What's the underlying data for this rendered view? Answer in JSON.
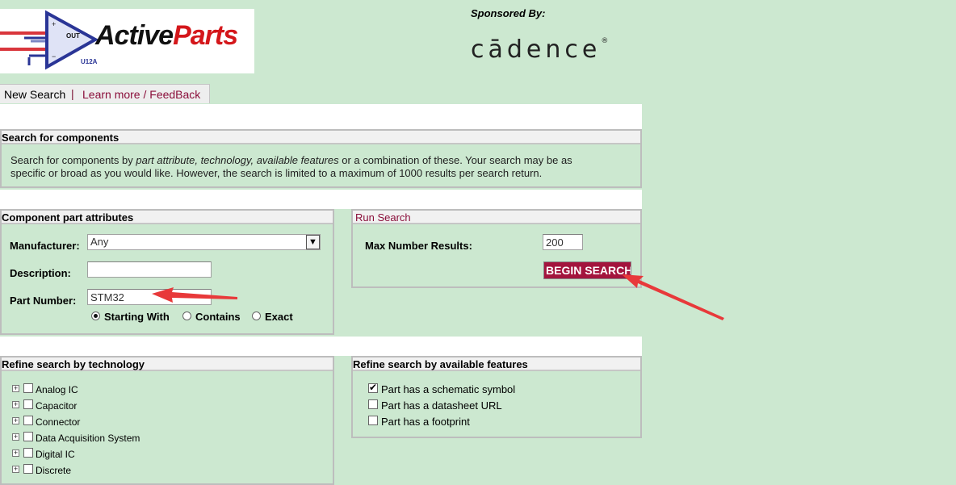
{
  "logo": {
    "prefix": "Active",
    "suffix": "Parts",
    "chip_label": "U12A",
    "out_label": "OUT"
  },
  "sponsor": {
    "label": "Sponsored By:",
    "brand": "cādence",
    "reg": "®"
  },
  "nav": {
    "new_search": "New Search",
    "separator": "|",
    "learn_more": "Learn more / FeedBack"
  },
  "intro": {
    "title": "Search for components",
    "line1_a": "Search for components by ",
    "line1_b": "part attribute, technology, available features",
    "line1_c": " or a combination of these. Your search may be as",
    "line2": "specific or broad as you would like. However, the search is limited to a maximum of 1000 results per search return."
  },
  "attributes": {
    "title": "Component part attributes",
    "manufacturer_label": "Manufacturer:",
    "manufacturer_value": "Any",
    "description_label": "Description:",
    "description_value": "",
    "part_number_label": "Part Number:",
    "part_number_value": "STM32",
    "match_options": [
      "Starting With",
      "Contains",
      "Exact"
    ],
    "match_selected": "Starting With"
  },
  "run": {
    "title": "Run Search",
    "max_label": "Max Number Results:",
    "max_value": "200",
    "begin_label": "BEGIN SEARCH"
  },
  "technology": {
    "title": "Refine search by technology",
    "items": [
      "Analog IC",
      "Capacitor",
      "Connector",
      "Data Acquisition System",
      "Digital IC",
      "Discrete"
    ]
  },
  "features": {
    "title": "Refine search by available features",
    "items": [
      {
        "label": "Part has a schematic symbol",
        "checked": true
      },
      {
        "label": "Part has a datasheet URL",
        "checked": false
      },
      {
        "label": "Part has a footprint",
        "checked": false
      }
    ]
  },
  "colors": {
    "background": "#cce8d0",
    "accent": "#a3143d",
    "arrow": "#e8393a"
  }
}
